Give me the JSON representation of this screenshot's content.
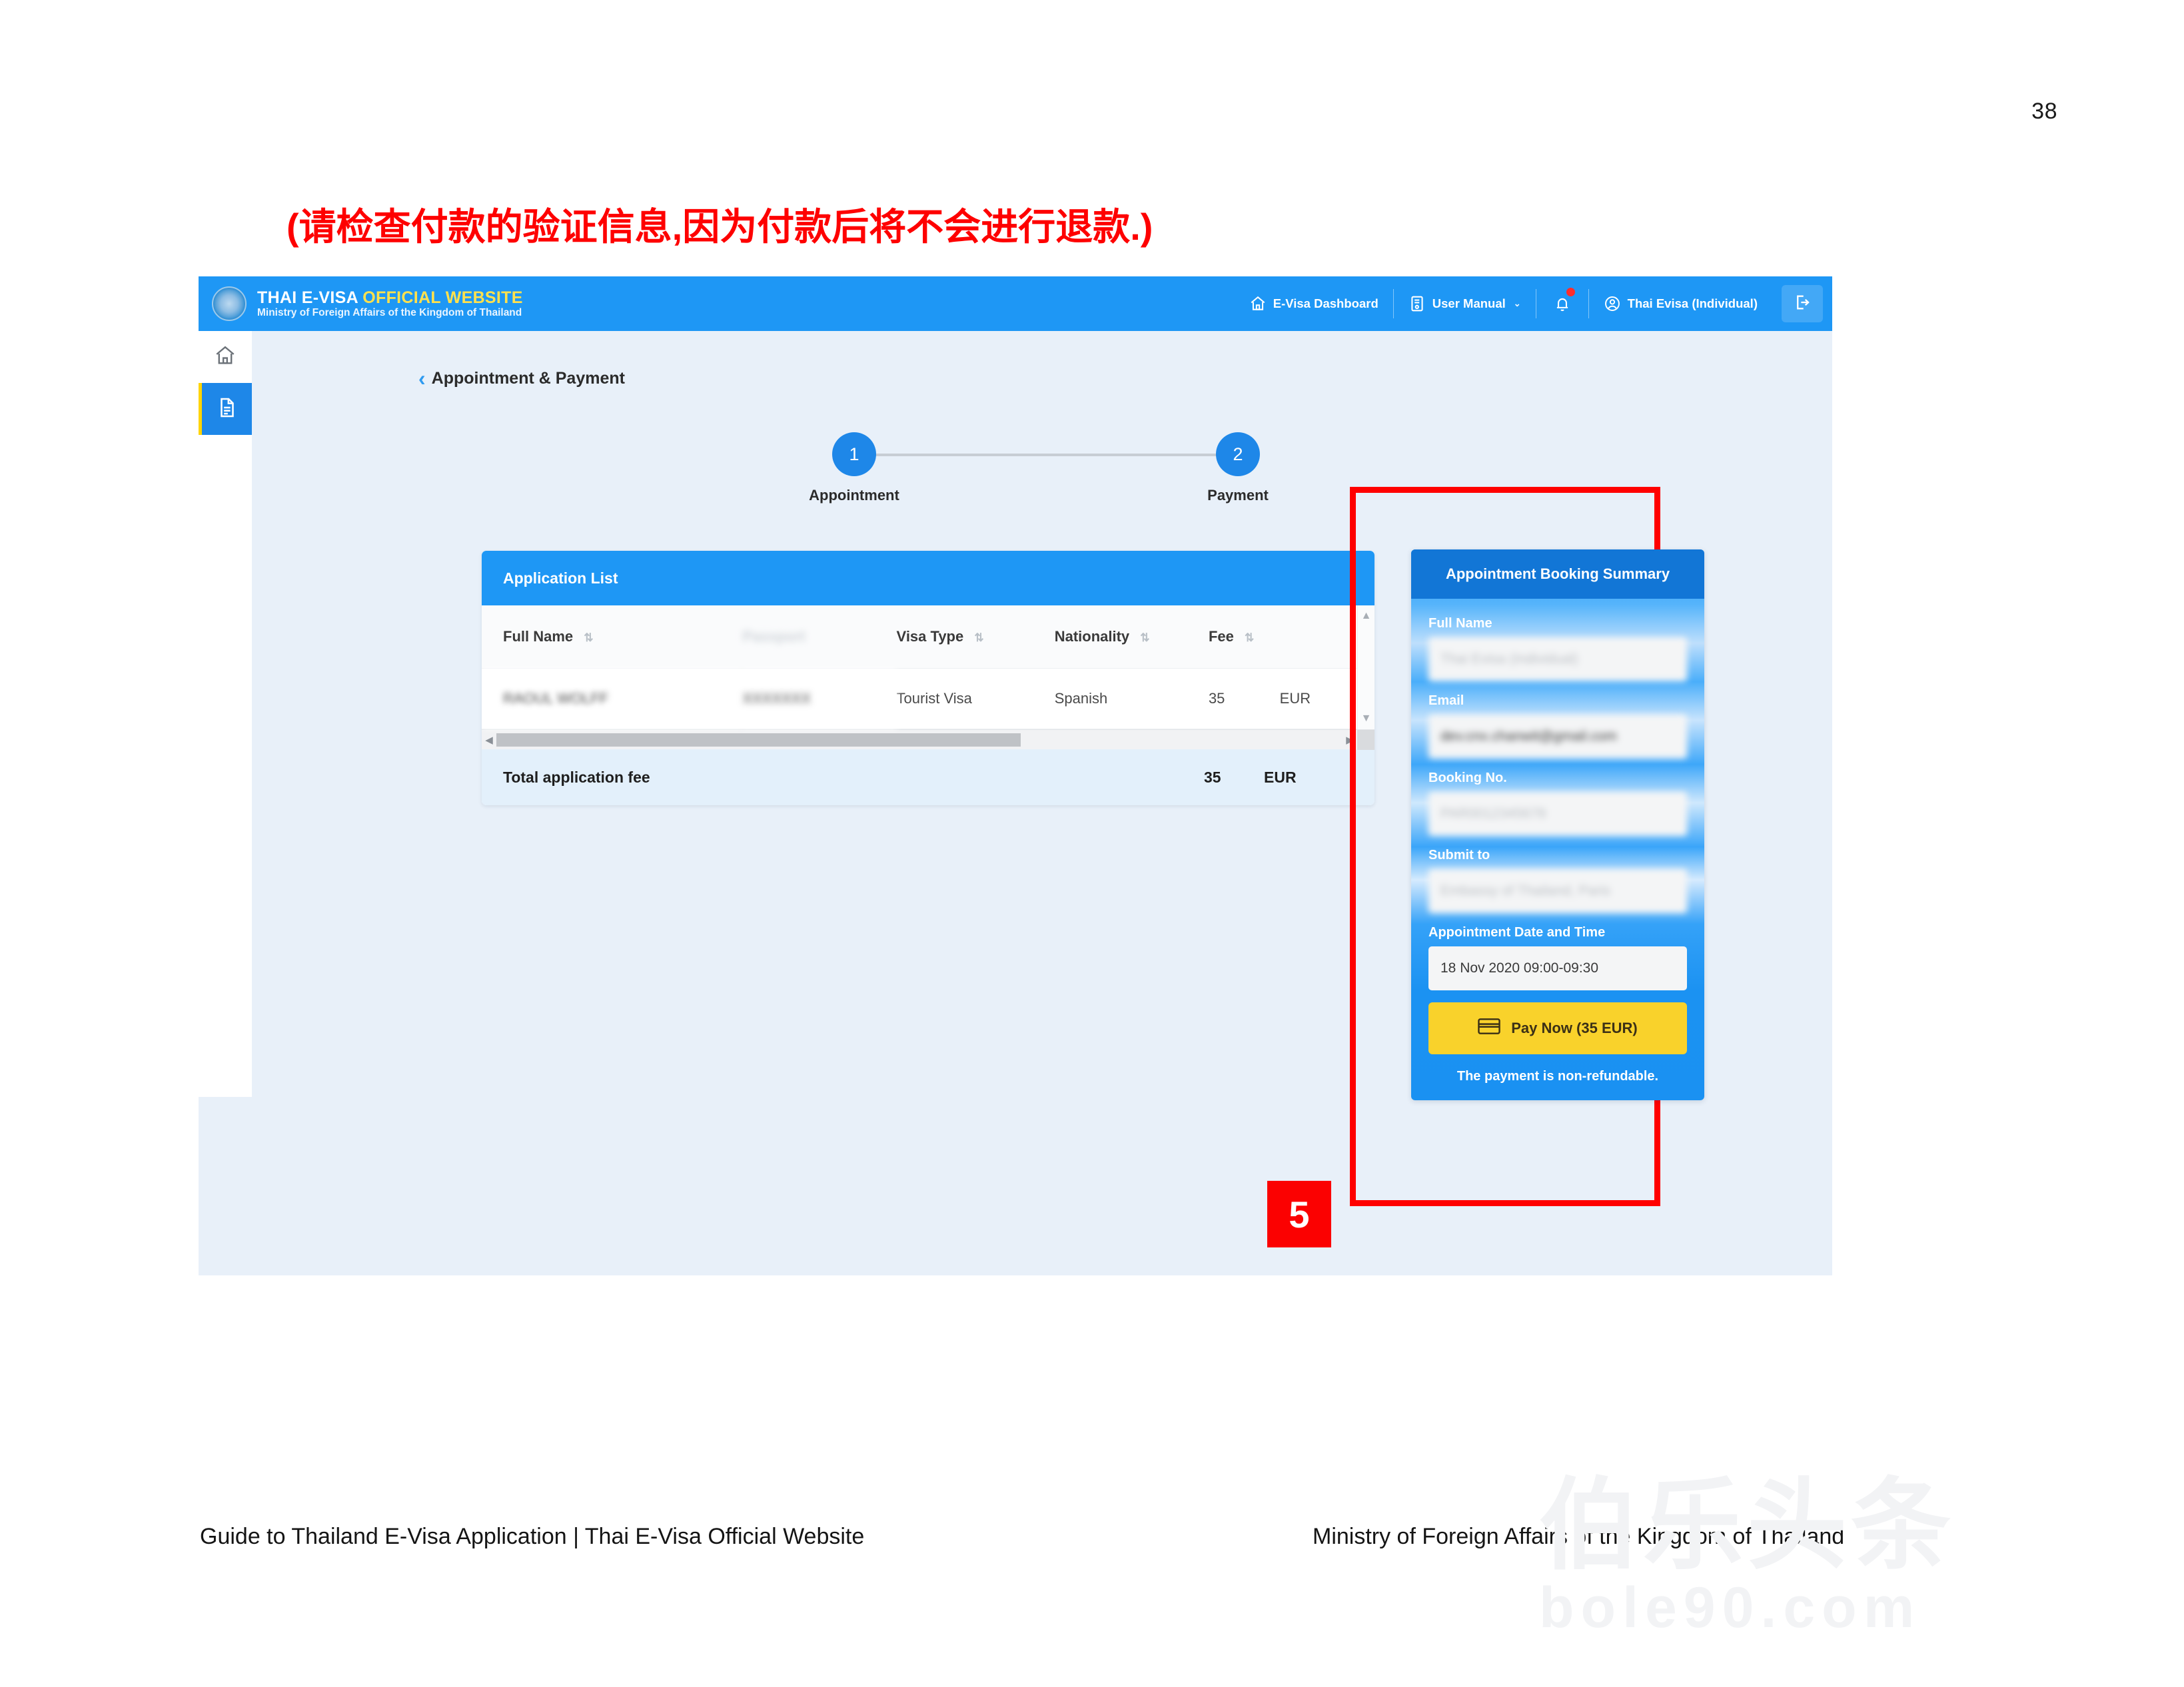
{
  "document": {
    "page_number": "38",
    "annotation_note": "(请检查付款的验证信息,因为付款后将不会进行退款.)",
    "footer_left": "Guide to Thailand E-Visa Application | Thai E-Visa Official Website",
    "footer_right": "Ministry of Foreign Affairs of the Kingdom of Thailand",
    "watermark_line1": "伯乐头条",
    "watermark_line2": "bole90.com"
  },
  "header": {
    "brand_primary": "THAI E-VISA",
    "brand_secondary": "OFFICIAL WEBSITE",
    "brand_subtitle": "Ministry of Foreign Affairs of the Kingdom of Thailand",
    "nav": [
      {
        "label": "E-Visa Dashboard",
        "icon": "home-icon"
      },
      {
        "label": "User Manual",
        "icon": "book-icon",
        "caret": "⌄"
      },
      {
        "label": "",
        "icon": "bell-icon"
      },
      {
        "label": "Thai Evisa (Individual)",
        "icon": "user-circle-icon"
      },
      {
        "label": "",
        "icon": "logout-icon"
      }
    ]
  },
  "sidebar": {
    "items": [
      {
        "name": "home",
        "icon": "home-icon",
        "active": false
      },
      {
        "name": "applications",
        "icon": "document-icon",
        "active": true
      }
    ]
  },
  "breadcrumb": {
    "back_icon": "‹",
    "label": "Appointment & Payment"
  },
  "stepper": {
    "steps": [
      {
        "number": "1",
        "label": "Appointment"
      },
      {
        "number": "2",
        "label": "Payment"
      }
    ]
  },
  "application_list": {
    "title": "Application List",
    "columns": [
      {
        "label": "Full Name",
        "sortable": true
      },
      {
        "label": "",
        "sortable": false
      },
      {
        "label": "Visa Type",
        "sortable": true
      },
      {
        "label": "Nationality",
        "sortable": true
      },
      {
        "label": "Fee",
        "sortable": true
      },
      {
        "label": "",
        "sortable": false
      }
    ],
    "rows": [
      {
        "full_name": "RAOUL WOLFF",
        "redacted": "",
        "visa_type": "Tourist Visa",
        "nationality": "Spanish",
        "fee": "35",
        "currency": "EUR"
      }
    ],
    "total_label": "Total application fee",
    "total_fee": "35",
    "total_currency": "EUR",
    "sort_glyph": "⇅",
    "scroll_up": "▲",
    "scroll_down": "▼",
    "scroll_left": "◀",
    "scroll_right": "▶"
  },
  "summary": {
    "title": "Appointment Booking Summary",
    "fields": [
      {
        "label": "Full Name",
        "value": "Thai Evisa (Individual)",
        "redacted": true,
        "placeholder_style": true
      },
      {
        "label": "Email",
        "value": "dev.cnx.chanwit@gmail.com",
        "redacted": true,
        "placeholder_style": false
      },
      {
        "label": "Booking No.",
        "value": "PAR0012345678",
        "redacted": true,
        "placeholder_style": true
      },
      {
        "label": "Submit to",
        "value": "Embassy of Thailand, Paris",
        "redacted": true,
        "placeholder_style": true
      },
      {
        "label": "Appointment Date and Time",
        "value": "18 Nov 2020 09:00-09:30",
        "redacted": false,
        "placeholder_style": false
      }
    ],
    "pay_button_label": "Pay Now (35 EUR)",
    "pay_button_icon": "credit-card-icon",
    "non_refundable_note": "The payment is non-refundable."
  },
  "callout": {
    "step_badge": "5",
    "highlight_color": "#ff0000",
    "badge_color": "#fb0101"
  },
  "colors": {
    "brand_blue": "#1e97f5",
    "header_dark_blue": "#1276d6",
    "accent_yellow": "#f9d22b",
    "page_bg": "#e8f0f9",
    "note_red": "#fe0000"
  }
}
